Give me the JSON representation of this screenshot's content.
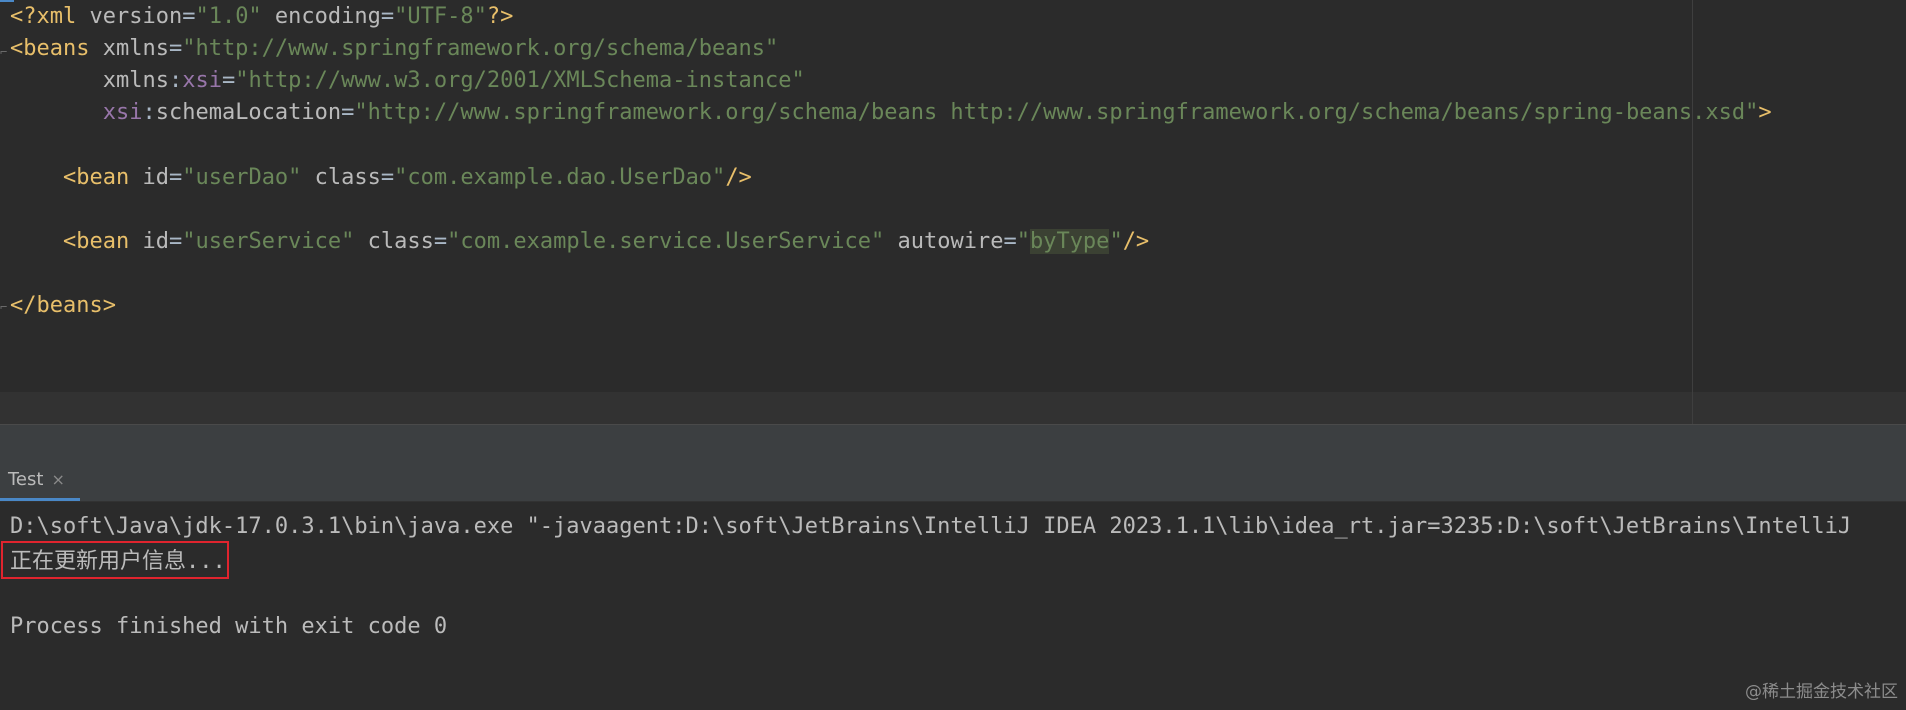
{
  "editor": {
    "lines": [
      [
        {
          "c": "t-tag",
          "t": "<?xml "
        },
        {
          "c": "t-attr",
          "t": "version"
        },
        {
          "c": "t-punct",
          "t": "="
        },
        {
          "c": "t-val",
          "t": "\"1.0\""
        },
        {
          "c": "t-attr",
          "t": " encoding"
        },
        {
          "c": "t-punct",
          "t": "="
        },
        {
          "c": "t-val",
          "t": "\"UTF-8\""
        },
        {
          "c": "t-tag",
          "t": "?>"
        }
      ],
      [
        {
          "c": "t-tag",
          "t": "<beans "
        },
        {
          "c": "t-attr",
          "t": "xmlns"
        },
        {
          "c": "t-punct",
          "t": "="
        },
        {
          "c": "t-val",
          "t": "\"http://www.springframework.org/schema/beans\""
        }
      ],
      [
        {
          "c": "t-punct",
          "t": "       "
        },
        {
          "c": "t-attr",
          "t": "xmlns"
        },
        {
          "c": "t-punct",
          "t": ":"
        },
        {
          "c": "t-ns",
          "t": "xsi"
        },
        {
          "c": "t-punct",
          "t": "="
        },
        {
          "c": "t-val",
          "t": "\"http://www.w3.org/2001/XMLSchema-instance\""
        }
      ],
      [
        {
          "c": "t-punct",
          "t": "       "
        },
        {
          "c": "t-ns",
          "t": "xsi"
        },
        {
          "c": "t-punct",
          "t": ":"
        },
        {
          "c": "t-attr",
          "t": "schemaLocation"
        },
        {
          "c": "t-punct",
          "t": "="
        },
        {
          "c": "t-val",
          "t": "\"http://www.springframework.org/schema/beans http://www.springframework.org/schema/beans/spring-beans.xsd\""
        },
        {
          "c": "t-tag",
          "t": ">"
        }
      ],
      [],
      [
        {
          "c": "t-punct",
          "t": "    "
        },
        {
          "c": "t-tag",
          "t": "<bean "
        },
        {
          "c": "t-attr",
          "t": "id"
        },
        {
          "c": "t-punct",
          "t": "="
        },
        {
          "c": "t-val",
          "t": "\"userDao\""
        },
        {
          "c": "t-attr",
          "t": " class"
        },
        {
          "c": "t-punct",
          "t": "="
        },
        {
          "c": "t-val",
          "t": "\"com.example.dao.UserDao\""
        },
        {
          "c": "t-tag",
          "t": "/>"
        }
      ],
      [],
      [
        {
          "c": "t-punct",
          "t": "    "
        },
        {
          "c": "t-tag",
          "t": "<bean "
        },
        {
          "c": "t-attr",
          "t": "id"
        },
        {
          "c": "t-punct",
          "t": "="
        },
        {
          "c": "t-val",
          "t": "\"userService\""
        },
        {
          "c": "t-attr",
          "t": " class"
        },
        {
          "c": "t-punct",
          "t": "="
        },
        {
          "c": "t-val",
          "t": "\"com.example.service.UserService\""
        },
        {
          "c": "t-attr",
          "t": " autowire"
        },
        {
          "c": "t-punct",
          "t": "="
        },
        {
          "c": "t-val",
          "t": "\""
        },
        {
          "c": "t-val hl",
          "t": "byType"
        },
        {
          "c": "t-val",
          "t": "\""
        },
        {
          "c": "t-tag",
          "t": "/>"
        }
      ],
      [],
      [
        {
          "c": "t-tag",
          "t": "</beans>"
        }
      ]
    ]
  },
  "run_panel": {
    "tab_label": "Test",
    "tab_close_glyph": "×",
    "console_lines": [
      "D:\\soft\\Java\\jdk-17.0.3.1\\bin\\java.exe \"-javaagent:D:\\soft\\JetBrains\\IntelliJ IDEA 2023.1.1\\lib\\idea_rt.jar=3235:D:\\soft\\JetBrains\\IntelliJ",
      "正在更新用户信息...",
      "",
      "Process finished with exit code 0"
    ]
  },
  "watermark": "@稀土掘金技术社区",
  "colors": {
    "background": "#2b2b2b",
    "tag": "#e8bf6a",
    "attribute": "#bababa",
    "namespace": "#9876aa",
    "string": "#6a8759",
    "highlight_box": "#e0242e"
  }
}
